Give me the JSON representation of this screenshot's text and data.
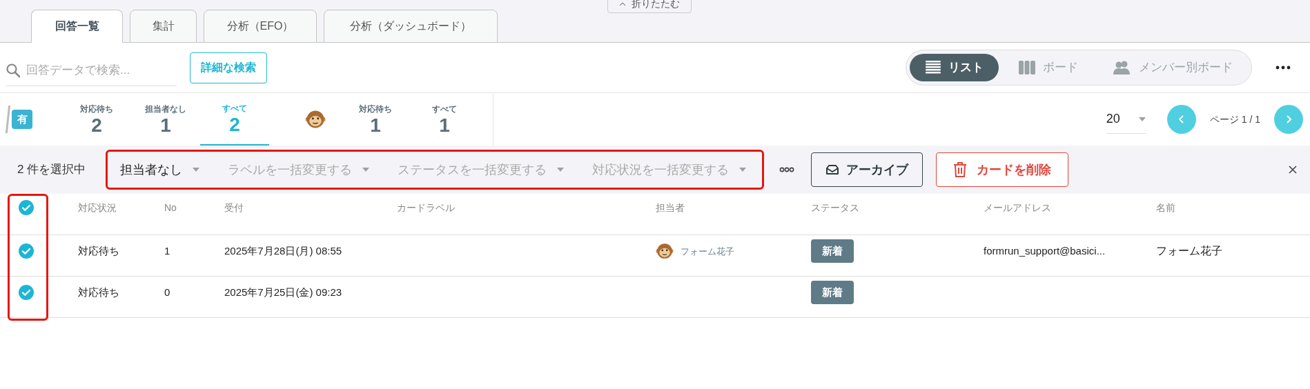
{
  "collapse_button": {
    "label": "折りたたむ"
  },
  "tabs": [
    {
      "label": "回答一覧",
      "selected": true
    },
    {
      "label": "集計",
      "selected": false
    },
    {
      "label": "分析（EFO）",
      "selected": false
    },
    {
      "label": "分析（ダッシュボード）",
      "selected": false
    }
  ],
  "search": {
    "placeholder": "回答データで検索...",
    "advanced_button": "詳細な検索"
  },
  "view_switch": [
    {
      "label": "リスト",
      "kind": "list",
      "selected": true
    },
    {
      "label": "ボード",
      "kind": "board",
      "selected": false
    },
    {
      "label": "メンバー別ボード",
      "kind": "members",
      "selected": false
    }
  ],
  "stat_groups": [
    {
      "kind": "badge",
      "badge": "有",
      "items": [
        {
          "label": "対応待ち",
          "count": "2",
          "selected": false
        },
        {
          "label": "担当者なし",
          "count": "1",
          "selected": false
        },
        {
          "label": "すべて",
          "count": "2",
          "selected": true
        }
      ]
    },
    {
      "kind": "avatar",
      "items": [
        {
          "label": "対応待ち",
          "count": "1",
          "selected": false
        },
        {
          "label": "すべて",
          "count": "1",
          "selected": false
        }
      ]
    }
  ],
  "pagination": {
    "per_page": "20",
    "page_label": "ページ 1 / 1"
  },
  "bulk_bar": {
    "selection": "2 件を選択中",
    "dropdowns": [
      {
        "label": "担当者なし",
        "placeholder": false
      },
      {
        "label": "ラベルを一括変更する",
        "placeholder": true
      },
      {
        "label": "ステータスを一括変更する",
        "placeholder": true
      },
      {
        "label": "対応状況を一括変更する",
        "placeholder": true
      }
    ],
    "archive": "アーカイブ",
    "delete": "カードを削除"
  },
  "table": {
    "all_selected": true,
    "columns": [
      "対応状況",
      "No",
      "受付",
      "カードラベル",
      "担当者",
      "ステータス",
      "メールアドレス",
      "名前"
    ],
    "rows": [
      {
        "selected": true,
        "status": "対応待ち",
        "no": "1",
        "received": "2025年7月28日(月) 08:55",
        "assignee": "フォーム花子",
        "state": "新着",
        "email": "formrun_support@basici...",
        "name": "フォーム花子"
      },
      {
        "selected": true,
        "status": "対応待ち",
        "no": "0",
        "received": "2025年7月25日(金) 09:23",
        "state": "新着"
      }
    ]
  }
}
